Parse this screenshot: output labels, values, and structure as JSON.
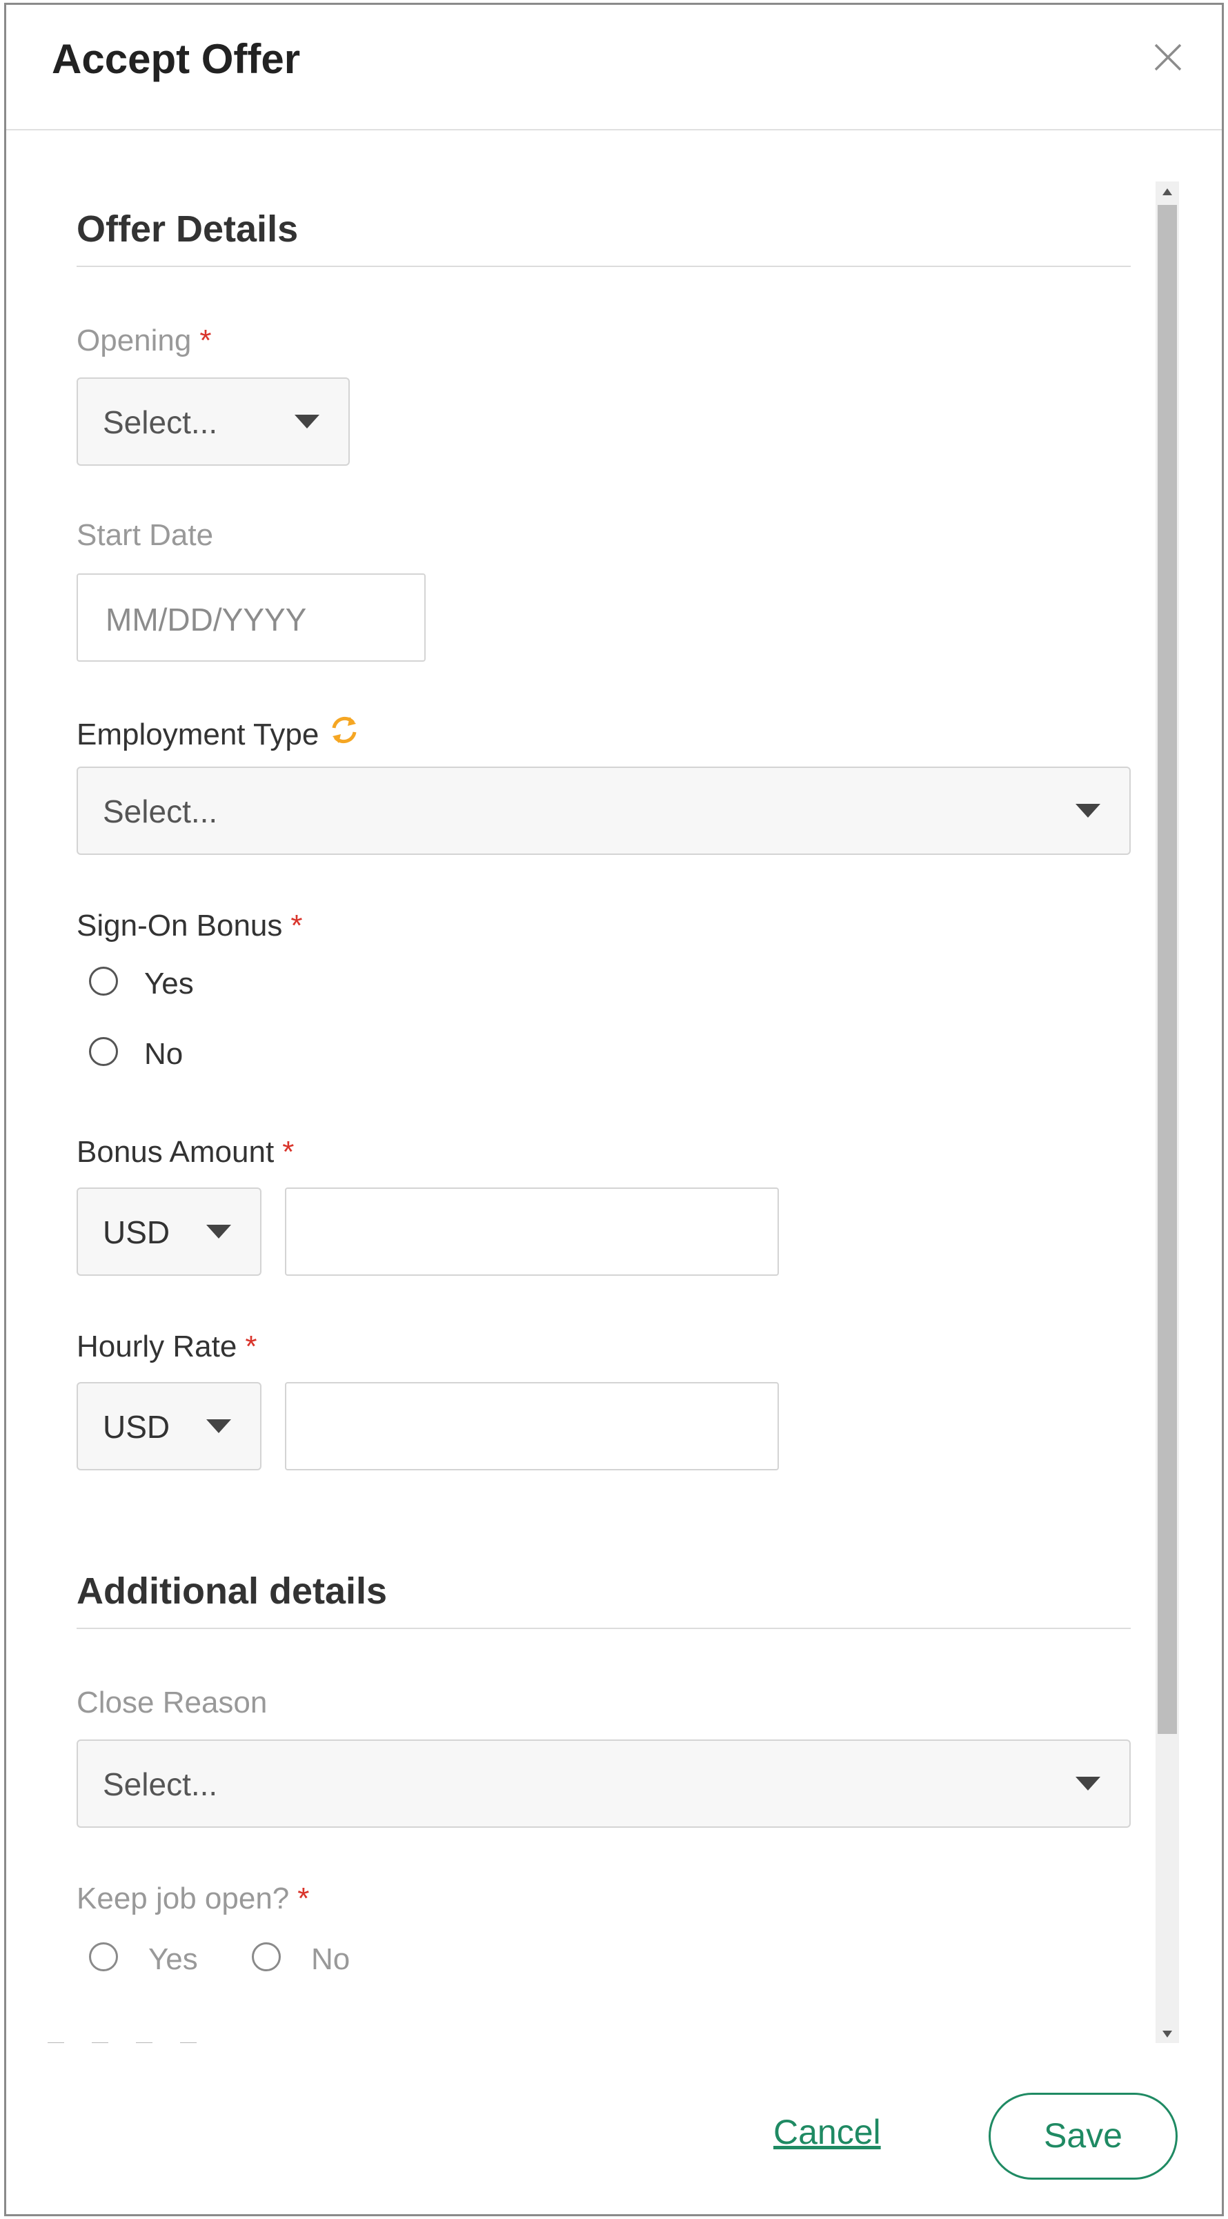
{
  "modal": {
    "title": "Accept Offer",
    "close_icon": "close-icon"
  },
  "offer_details": {
    "section_title": "Offer Details",
    "opening": {
      "label": "Opening",
      "required": "*",
      "value": "Select..."
    },
    "start_date": {
      "label": "Start Date",
      "placeholder": "MM/DD/YYYY"
    },
    "employment_type": {
      "label": "Employment Type",
      "icon": "sync-icon",
      "value": "Select..."
    },
    "sign_on_bonus": {
      "label": "Sign-On Bonus",
      "required": "*",
      "options": [
        "Yes",
        "No"
      ]
    },
    "bonus_amount": {
      "label": "Bonus Amount",
      "required": "*",
      "currency": "USD",
      "amount": ""
    },
    "hourly_rate": {
      "label": "Hourly Rate",
      "required": "*",
      "currency": "USD",
      "amount": ""
    }
  },
  "additional_details": {
    "section_title": "Additional details",
    "close_reason": {
      "label": "Close Reason",
      "value": "Select..."
    },
    "keep_job_open": {
      "label": "Keep job open?",
      "required": "*",
      "options": [
        "Yes",
        "No"
      ]
    }
  },
  "footer": {
    "cancel_label": "Cancel",
    "save_label": "Save"
  },
  "colors": {
    "accent": "#1f8a63",
    "required": "#d9342b",
    "sync_icon": "#f5a623"
  }
}
